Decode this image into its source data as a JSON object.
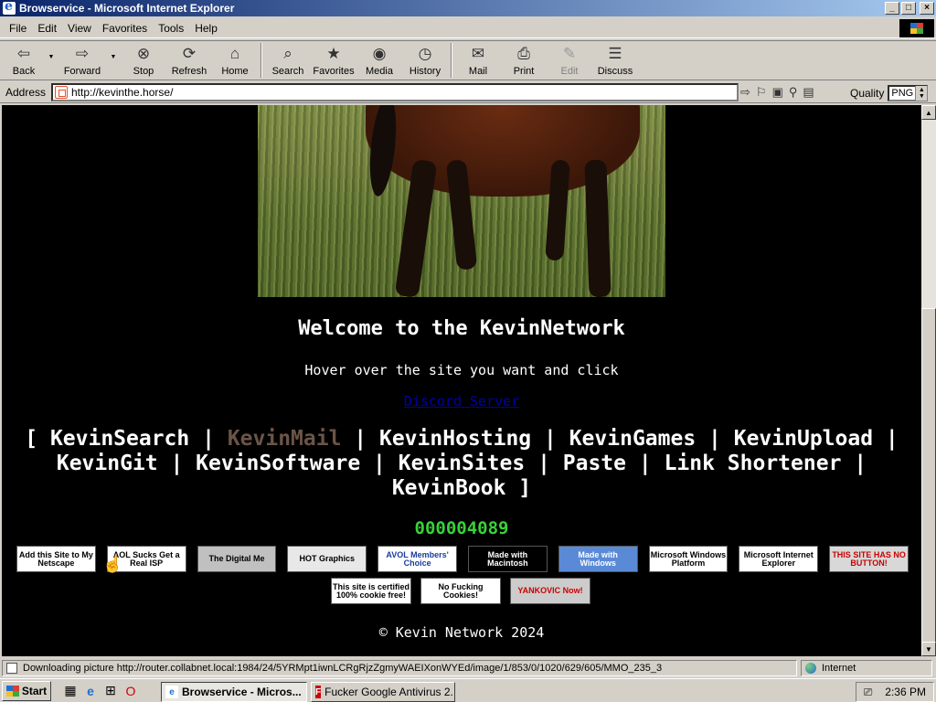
{
  "window": {
    "title": "Browservice - Microsoft Internet Explorer",
    "controls": {
      "minimize": "_",
      "maximize": "□",
      "close": "×"
    }
  },
  "menu": [
    "File",
    "Edit",
    "View",
    "Favorites",
    "Tools",
    "Help"
  ],
  "toolbar": [
    {
      "label": "Back",
      "icon": "back-arrow-icon",
      "glyph": "⇦"
    },
    {
      "label": "Forward",
      "icon": "forward-arrow-icon",
      "glyph": "⇨"
    },
    {
      "label": "Stop",
      "icon": "stop-icon",
      "glyph": "⊗"
    },
    {
      "label": "Refresh",
      "icon": "refresh-icon",
      "glyph": "⟳"
    },
    {
      "label": "Home",
      "icon": "home-icon",
      "glyph": "⌂"
    },
    {
      "label": "Search",
      "icon": "search-icon",
      "glyph": "⌕"
    },
    {
      "label": "Favorites",
      "icon": "favorites-icon",
      "glyph": "★"
    },
    {
      "label": "Media",
      "icon": "media-icon",
      "glyph": "◉"
    },
    {
      "label": "History",
      "icon": "history-icon",
      "glyph": "◷"
    },
    {
      "label": "Mail",
      "icon": "mail-icon",
      "glyph": "✉"
    },
    {
      "label": "Print",
      "icon": "print-icon",
      "glyph": "⎙"
    },
    {
      "label": "Edit",
      "icon": "edit-icon",
      "glyph": "✎"
    },
    {
      "label": "Discuss",
      "icon": "discuss-icon",
      "glyph": "☰"
    }
  ],
  "address": {
    "label": "Address",
    "url": "http://kevinthe.horse/"
  },
  "quality": {
    "label": "Quality",
    "value": "PNG"
  },
  "page": {
    "welcome": "Welcome to the KevinNetwork",
    "hover_text": "Hover over the site you want and click",
    "discord": "Discord Server",
    "nav_links": [
      "KevinSearch",
      "KevinMail",
      "KevinHosting",
      "KevinGames",
      "KevinUpload",
      "KevinGit",
      "KevinSoftware",
      "KevinSites",
      "Paste",
      "Link Shortener",
      "KevinBook"
    ],
    "counter": "000004089",
    "footer": "© Kevin Network 2024"
  },
  "badges_row1": [
    {
      "text": "Add this Site to My Netscape",
      "bg": "#ffffff",
      "fg": "#000000"
    },
    {
      "text": "AOL Sucks Get a Real ISP",
      "bg": "#ffffff",
      "fg": "#000000"
    },
    {
      "text": "The Digital Me",
      "bg": "#c0c0c0",
      "fg": "#000000"
    },
    {
      "text": "HOT Graphics",
      "bg": "#e8e8e8",
      "fg": "#000000"
    },
    {
      "text": "AVOL Members' Choice",
      "bg": "#ffffff",
      "fg": "#1a3c9c"
    },
    {
      "text": "Made with Macintosh",
      "bg": "#000000",
      "fg": "#ffffff"
    },
    {
      "text": "Made with Windows",
      "bg": "#5a8ad6",
      "fg": "#ffffff"
    },
    {
      "text": "Microsoft Windows Platform",
      "bg": "#ffffff",
      "fg": "#000000"
    },
    {
      "text": "Microsoft Internet Explorer",
      "bg": "#ffffff",
      "fg": "#000000"
    },
    {
      "text": "THIS SITE HAS NO BUTTON!",
      "bg": "#d8d8d8",
      "fg": "#cc0000"
    }
  ],
  "badges_row2": [
    {
      "text": "This site is certified 100% cookie free!",
      "bg": "#ffffff",
      "fg": "#000000"
    },
    {
      "text": "No Fucking Cookies!",
      "bg": "#ffffff",
      "fg": "#000000"
    },
    {
      "text": "YANKOVIC Now!",
      "bg": "#cccccc",
      "fg": "#cc0000"
    }
  ],
  "status": {
    "text": "Downloading picture http://router.collabnet.local:1984/24/5YRMpt1iwnLCRgRjzZgmyWAEIXonWYEd/image/1/853/0/1020/629/605/MMO_235_3",
    "zone": "Internet"
  },
  "taskbar": {
    "start": "Start",
    "tasks": [
      "Browservice - Micros...",
      "Fucker Google Antivirus 2..."
    ],
    "clock": "2:36 PM"
  }
}
